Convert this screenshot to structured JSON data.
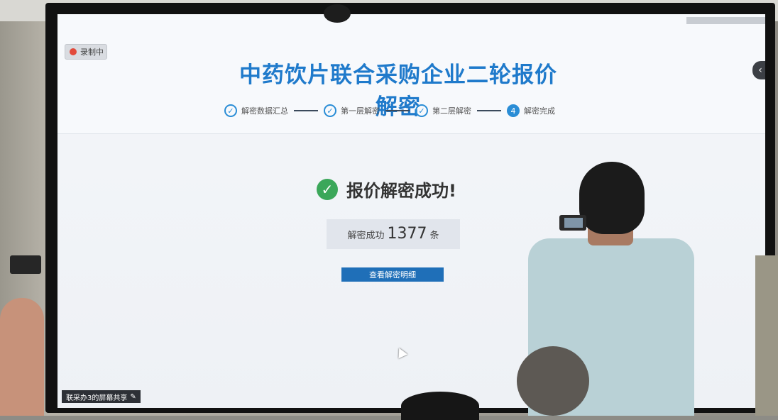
{
  "presentation": {
    "recording_label": "录制中",
    "title": "中药饮片联合采购企业二轮报价解密",
    "steps": [
      {
        "label": "解密数据汇总",
        "state": "done"
      },
      {
        "label": "第一层解密",
        "state": "done"
      },
      {
        "label": "第二层解密",
        "state": "done"
      },
      {
        "label": "解密完成",
        "state": "active",
        "number": "4"
      }
    ],
    "success_title": "报价解密成功!",
    "result": {
      "prefix": "解密成功",
      "count": "1377",
      "suffix": "条"
    },
    "view_button": "查看解密明细",
    "share_label": "联采办3的屏幕共享"
  },
  "colors": {
    "accent": "#1f7acb",
    "success": "#3ba75a",
    "button": "#1f6fb8"
  },
  "icons": [
    "check-circle-icon",
    "record-dot-icon",
    "chevron-left-icon",
    "edit-pencil-icon",
    "mouse-cursor-icon"
  ]
}
